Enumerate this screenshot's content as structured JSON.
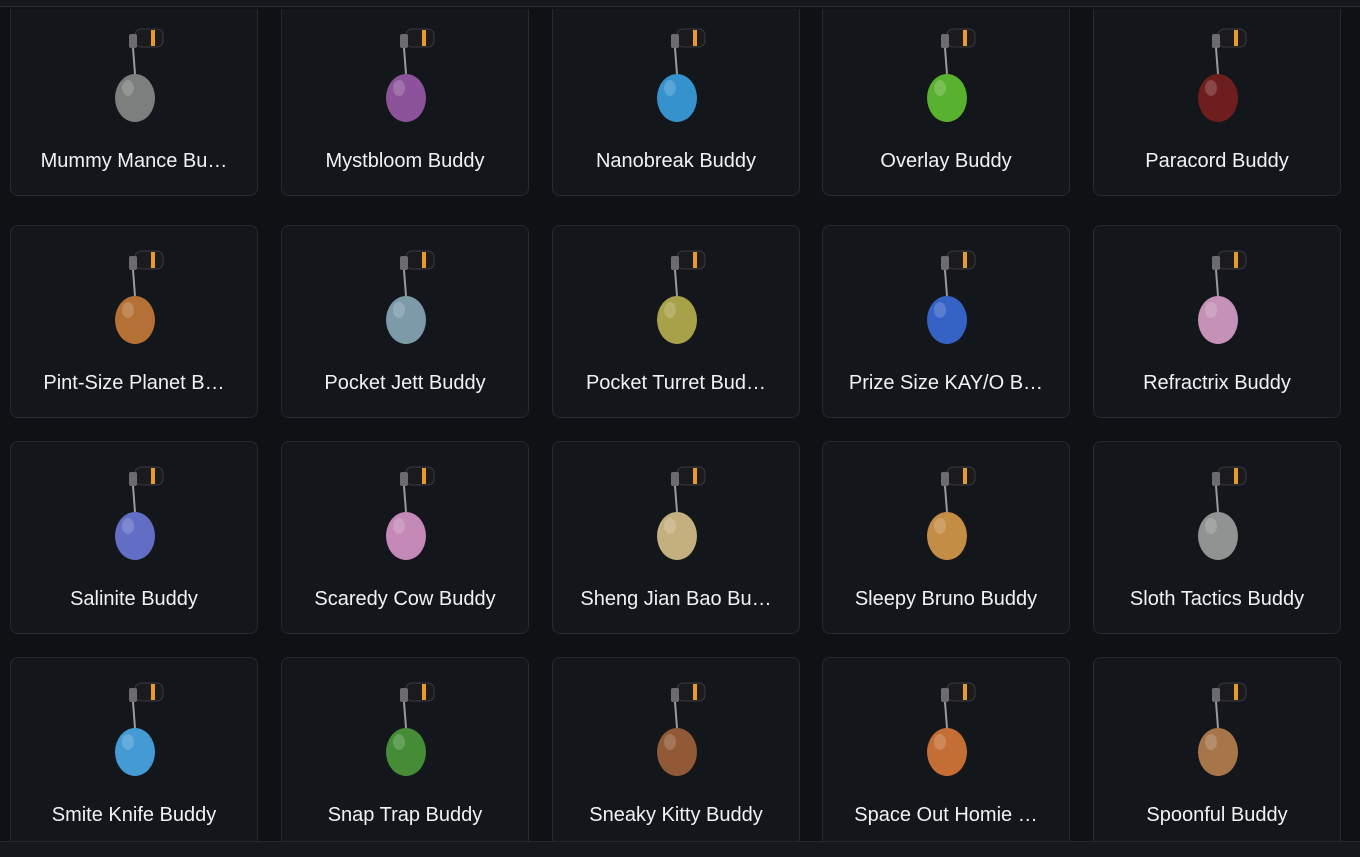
{
  "colors": {
    "background": "#0f1115",
    "card": "#13161b",
    "card_border": "#262a31",
    "text": "#f2f2f2",
    "clip_accent": "#e89a2c"
  },
  "buddies": [
    {
      "label": "Mummy Mance Bu…",
      "icon": "mummy-mance-buddy-icon",
      "color": "#8a8a8a"
    },
    {
      "label": "Mystbloom Buddy",
      "icon": "mystbloom-buddy-icon",
      "color": "#9a5aa8"
    },
    {
      "label": "Nanobreak Buddy",
      "icon": "nanobreak-buddy-icon",
      "color": "#3aa0e0"
    },
    {
      "label": "Overlay Buddy",
      "icon": "overlay-buddy-icon",
      "color": "#62c233"
    },
    {
      "label": "Paracord Buddy",
      "icon": "paracord-buddy-icon",
      "color": "#7a1f1f"
    },
    {
      "label": "Pint-Size Planet B…",
      "icon": "pint-size-planet-buddy-icon",
      "color": "#c87a3a"
    },
    {
      "label": "Pocket Jett Buddy",
      "icon": "pocket-jett-buddy-icon",
      "color": "#8aa8b8"
    },
    {
      "label": "Pocket Turret Bud…",
      "icon": "pocket-turret-buddy-icon",
      "color": "#b8b050"
    },
    {
      "label": "Prize Size KAY/O B…",
      "icon": "prize-size-kayo-buddy-icon",
      "color": "#3a6ad8"
    },
    {
      "label": "Refractrix Buddy",
      "icon": "refractrix-buddy-icon",
      "color": "#d8a0c8"
    },
    {
      "label": "Salinite Buddy",
      "icon": "salinite-buddy-icon",
      "color": "#6c78d8"
    },
    {
      "label": "Scaredy Cow Buddy",
      "icon": "scaredy-cow-buddy-icon",
      "color": "#d896c8"
    },
    {
      "label": "Sheng Jian Bao Bu…",
      "icon": "sheng-jian-bao-buddy-icon",
      "color": "#d8c08a"
    },
    {
      "label": "Sleepy Bruno Buddy",
      "icon": "sleepy-bruno-buddy-icon",
      "color": "#d89a4a"
    },
    {
      "label": "Sloth Tactics Buddy",
      "icon": "sloth-tactics-buddy-icon",
      "color": "#a0a0a0"
    },
    {
      "label": "Smite Knife Buddy",
      "icon": "smite-knife-buddy-icon",
      "color": "#4aa8e8"
    },
    {
      "label": "Snap Trap Buddy",
      "icon": "snap-trap-buddy-icon",
      "color": "#4a9a3a"
    },
    {
      "label": "Sneaky Kitty Buddy",
      "icon": "sneaky-kitty-buddy-icon",
      "color": "#a0603a"
    },
    {
      "label": "Space Out Homie …",
      "icon": "space-out-homie-buddy-icon",
      "color": "#d8783a"
    },
    {
      "label": "Spoonful Buddy",
      "icon": "spoonful-buddy-icon",
      "color": "#b88050"
    }
  ]
}
